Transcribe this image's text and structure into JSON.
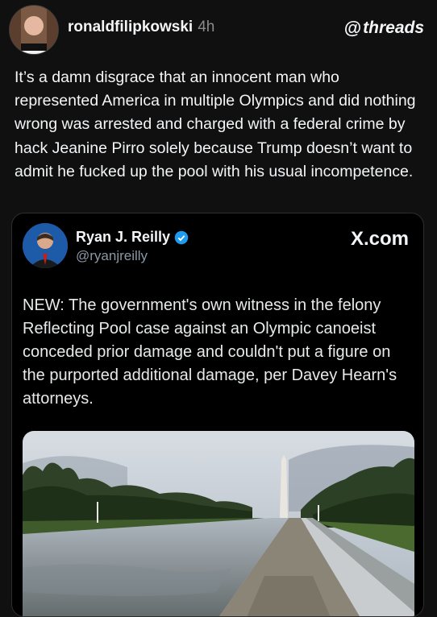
{
  "header": {
    "username": "ronaldfilipkowski",
    "time": "4h",
    "brand": "threads",
    "brand_icon": "threads-logo-icon"
  },
  "post": {
    "text": "It’s a damn disgrace that an innocent man who represented America in multiple Olympics and did nothing wrong was arrested and charged with a federal crime by hack Jeanine Pirro solely because Trump doesn’t want to admit he fucked up the pool with his usual incompetence."
  },
  "quoted": {
    "name": "Ryan J. Reilly",
    "handle": "@ryanjreilly",
    "brand": "X.com",
    "verified_icon": "verified-badge-icon",
    "text": "NEW: The government's own witness in the felony Reflecting Pool case against an Olympic canoeist conceded prior damage and couldn't put a figure on the purported additional damage, per Davey Hearn's attorneys.",
    "image_subject": "reflecting-pool-washington-monument-photo"
  },
  "colors": {
    "background": "#101010",
    "text": "#f3f5f7",
    "muted": "#8a8a8a",
    "verified": "#1d9bf0"
  }
}
